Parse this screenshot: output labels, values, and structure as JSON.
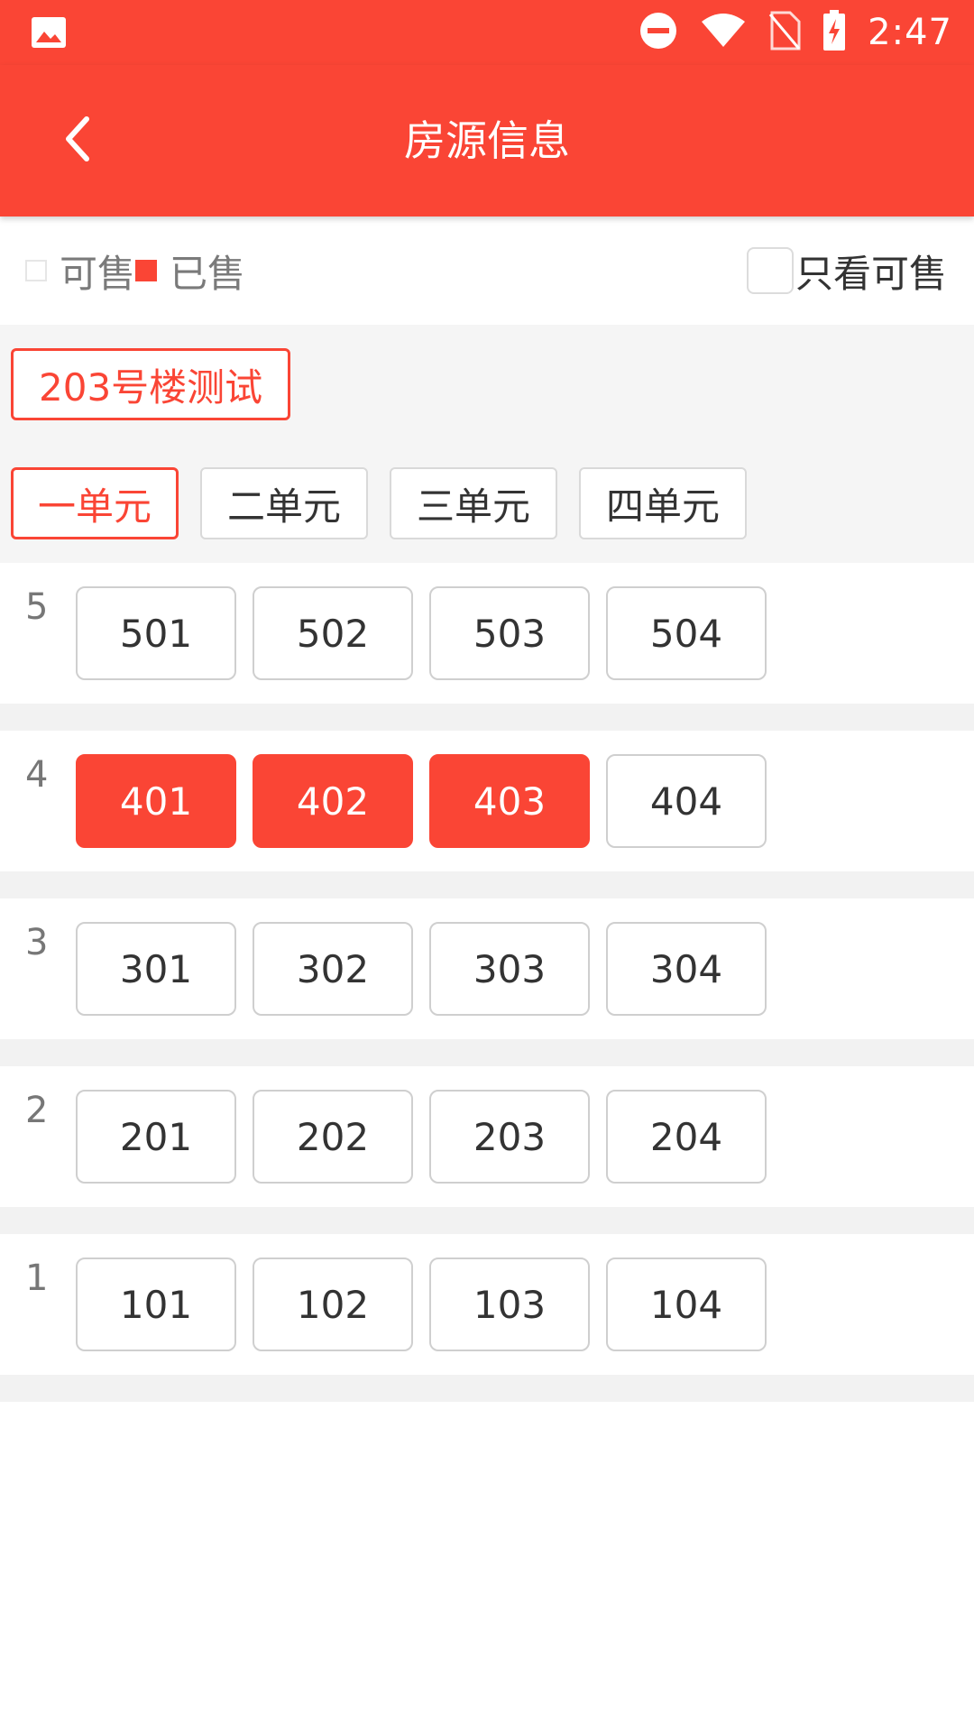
{
  "status_bar": {
    "time": "2:47",
    "icons": [
      "image-icon",
      "do-not-disturb-icon",
      "wifi-icon",
      "no-sim-icon",
      "battery-charging-icon"
    ]
  },
  "toolbar": {
    "title": "房源信息",
    "back_icon": "chevron-left-icon"
  },
  "legend": {
    "available_label": "可售",
    "sold_label": "已售",
    "only_available_label": "只看可售",
    "only_available_checked": false
  },
  "building": {
    "name": "203号楼测试"
  },
  "units": {
    "tabs": [
      {
        "label": "一单元",
        "active": true
      },
      {
        "label": "二单元",
        "active": false
      },
      {
        "label": "三单元",
        "active": false
      },
      {
        "label": "四单元",
        "active": false
      }
    ]
  },
  "floors": [
    {
      "floor": "5",
      "rooms": [
        {
          "number": "501",
          "sold": false
        },
        {
          "number": "502",
          "sold": false
        },
        {
          "number": "503",
          "sold": false
        },
        {
          "number": "504",
          "sold": false
        }
      ]
    },
    {
      "floor": "4",
      "rooms": [
        {
          "number": "401",
          "sold": true
        },
        {
          "number": "402",
          "sold": true
        },
        {
          "number": "403",
          "sold": true
        },
        {
          "number": "404",
          "sold": false
        }
      ]
    },
    {
      "floor": "3",
      "rooms": [
        {
          "number": "301",
          "sold": false
        },
        {
          "number": "302",
          "sold": false
        },
        {
          "number": "303",
          "sold": false
        },
        {
          "number": "304",
          "sold": false
        }
      ]
    },
    {
      "floor": "2",
      "rooms": [
        {
          "number": "201",
          "sold": false
        },
        {
          "number": "202",
          "sold": false
        },
        {
          "number": "203",
          "sold": false
        },
        {
          "number": "204",
          "sold": false
        }
      ]
    },
    {
      "floor": "1",
      "rooms": [
        {
          "number": "101",
          "sold": false
        },
        {
          "number": "102",
          "sold": false
        },
        {
          "number": "103",
          "sold": false
        },
        {
          "number": "104",
          "sold": false
        }
      ]
    }
  ],
  "colors": {
    "accent": "#fa4535",
    "sold": "#fa4535",
    "background_gray": "#f5f5f5"
  }
}
